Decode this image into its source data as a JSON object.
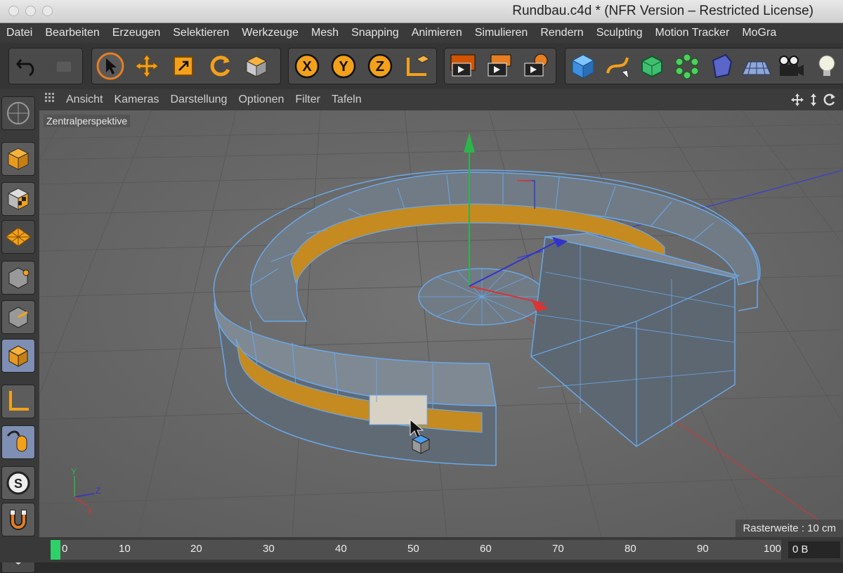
{
  "window": {
    "title": "Rundbau.c4d * (NFR Version – Restricted License)"
  },
  "menu": [
    "Datei",
    "Bearbeiten",
    "Erzeugen",
    "Selektieren",
    "Werkzeuge",
    "Mesh",
    "Snapping",
    "Animieren",
    "Simulieren",
    "Rendern",
    "Sculpting",
    "Motion Tracker",
    "MoGra"
  ],
  "toolbar": {
    "axes": [
      "X",
      "Y",
      "Z"
    ],
    "icons": [
      "undo-icon",
      "redo-icon",
      "select-cursor-icon",
      "move-icon",
      "scale-icon",
      "rotate-icon",
      "model-mode-icon",
      "x-axis-lock-icon",
      "y-axis-lock-icon",
      "z-axis-lock-icon",
      "coordinate-system-icon",
      "render-view-icon",
      "render-picture-viewer-icon",
      "render-settings-icon",
      "cube-primitive-icon",
      "spline-pen-icon",
      "subdivision-nurbs-icon",
      "cloner-icon",
      "deformer-icon",
      "floor-icon",
      "camera-icon",
      "light-icon"
    ]
  },
  "viewport_menu": [
    "Ansicht",
    "Kameras",
    "Darstellung",
    "Optionen",
    "Filter",
    "Tafeln"
  ],
  "viewport": {
    "label": "Zentralperspektive",
    "grid_spacing": "Rasterweite : 10 cm",
    "axis_labels": [
      "Y",
      "Z",
      "X"
    ]
  },
  "sidebar": {
    "icons": [
      "make-editable-icon",
      "model-mode-icon",
      "texture-mode-icon",
      "workplane-icon",
      "points-mode-icon",
      "edges-mode-icon",
      "polygons-mode-icon",
      "axis-mode-icon",
      "tweak-mode-icon",
      "solo-mode-icon",
      "snap-icon",
      "grid-icon"
    ],
    "active": "polygons-mode-icon"
  },
  "timeline": {
    "ticks": [
      "0",
      "10",
      "20",
      "30",
      "40",
      "50",
      "60",
      "70",
      "80",
      "90",
      "100"
    ],
    "current_frame": "0 B"
  },
  "colors": {
    "selection": "#e8a31c",
    "wireframe": "#6aa7e8",
    "accent": "#7f8fb3"
  }
}
